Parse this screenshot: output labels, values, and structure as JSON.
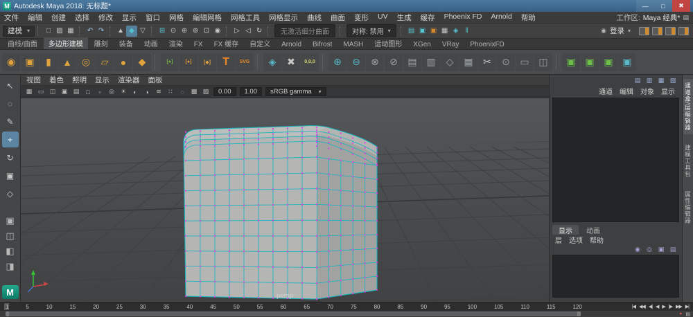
{
  "ui": {
    "chevron_down": "▾",
    "login_icon": "◉",
    "workspace_icon": "▤"
  },
  "title_bar": {
    "logo": "M",
    "title": "Autodesk Maya 2018: 无标题*",
    "minimize_glyph": "—",
    "maximize_glyph": "□",
    "close_glyph": "✖"
  },
  "menu_bar": {
    "items": [
      "文件",
      "编辑",
      "创建",
      "选择",
      "修改",
      "显示",
      "窗口",
      "网格",
      "编辑网格",
      "网格工具",
      "网格显示",
      "曲线",
      "曲面",
      "变形",
      "UV",
      "生成",
      "缓存",
      "Phoenix FD",
      "Arnold",
      "帮助"
    ],
    "workspace_label": "工作区:",
    "workspace_value": "Maya 经典*"
  },
  "status_line": {
    "mode_label": "建模",
    "login_label": "登录",
    "left_items": [
      {
        "type": "sep"
      },
      {
        "type": "icon",
        "name": "new-scene-icon",
        "glyph": "□",
        "color": "#c8c8c8"
      },
      {
        "type": "icon",
        "name": "open-scene-icon",
        "glyph": "▨",
        "color": "#c8c8c8"
      },
      {
        "type": "icon",
        "name": "save-scene-icon",
        "glyph": "▦",
        "color": "#c8c8c8"
      },
      {
        "type": "sep"
      },
      {
        "type": "icon",
        "name": "undo-icon",
        "glyph": "↶",
        "color": "#9fc6e8"
      },
      {
        "type": "icon",
        "name": "redo-icon",
        "glyph": "↷",
        "color": "#9fc6e8"
      },
      {
        "type": "sep"
      },
      {
        "type": "icon",
        "name": "select-hierarchy-icon",
        "glyph": "▲",
        "color": "#c8c8c8"
      },
      {
        "type": "icon",
        "name": "select-object-icon",
        "glyph": "◆",
        "color": "#54c3d0",
        "active": true
      },
      {
        "type": "icon",
        "name": "select-component-icon",
        "glyph": "▽",
        "color": "#c8c8c8"
      },
      {
        "type": "sep"
      },
      {
        "type": "icon",
        "name": "snap-grid-icon",
        "glyph": "⊞",
        "color": "#54c3d0"
      },
      {
        "type": "icon",
        "name": "snap-curve-icon",
        "glyph": "⊙",
        "color": "#c8c8c8"
      },
      {
        "type": "icon",
        "name": "snap-point-icon",
        "glyph": "⊕",
        "color": "#c8c8c8"
      },
      {
        "type": "icon",
        "name": "snap-center-icon",
        "glyph": "⊚",
        "color": "#c8c8c8"
      },
      {
        "type": "icon",
        "name": "snap-viewplane-icon",
        "glyph": "⊡",
        "color": "#c8c8c8"
      },
      {
        "type": "icon",
        "name": "make-live-icon",
        "glyph": "◉",
        "color": "#c8c8c8"
      },
      {
        "type": "sep"
      },
      {
        "type": "icon",
        "name": "input-connections-icon",
        "glyph": "▷",
        "color": "#c8c8c8"
      },
      {
        "type": "icon",
        "name": "output-connections-icon",
        "glyph": "◁",
        "color": "#c8c8c8"
      },
      {
        "type": "icon",
        "name": "construction-history-icon",
        "glyph": "↻",
        "color": "#c8c8c8"
      },
      {
        "type": "sep"
      },
      {
        "type": "field",
        "name": "subdiv-status-field",
        "label": "无激活细分曲面"
      },
      {
        "type": "sep"
      },
      {
        "type": "dropdown",
        "name": "symmetry-dropdown",
        "label": "对称: 禁用"
      },
      {
        "type": "sep"
      },
      {
        "type": "icon",
        "name": "open-render-view-icon",
        "glyph": "▤",
        "color": "#54c3d0"
      },
      {
        "type": "icon",
        "name": "render-frame-icon",
        "glyph": "▣",
        "color": "#54c3d0"
      },
      {
        "type": "icon",
        "name": "ipr-render-icon",
        "glyph": "▣",
        "color": "#d98a2b"
      },
      {
        "type": "icon",
        "name": "render-settings-icon",
        "glyph": "▦",
        "color": "#c8c8c8"
      },
      {
        "type": "icon",
        "name": "launch-render-icon",
        "glyph": "◈",
        "color": "#54c3d0"
      },
      {
        "type": "icon",
        "name": "pause-icon",
        "glyph": "‖",
        "color": "#54c3d0"
      }
    ],
    "right_items": [
      {
        "type": "icon",
        "name": "toggle-modeling-toolkit-icon",
        "cls": "panel-toggle"
      },
      {
        "type": "icon",
        "name": "toggle-attribute-editor-icon",
        "cls": "panel-toggle"
      },
      {
        "type": "icon",
        "name": "toggle-tool-settings-icon",
        "cls": "panel-toggle"
      },
      {
        "type": "icon",
        "name": "toggle-channel-box-icon",
        "cls": "panel-toggle"
      }
    ]
  },
  "shelf": {
    "tabs": [
      {
        "label": "曲线/曲面"
      },
      {
        "label": "多边形建模",
        "active": true
      },
      {
        "label": "雕刻"
      },
      {
        "label": "装备"
      },
      {
        "label": "动画"
      },
      {
        "label": "渲染"
      },
      {
        "label": "FX"
      },
      {
        "label": "FX 缓存"
      },
      {
        "label": "自定义"
      },
      {
        "label": "Arnold"
      },
      {
        "label": "Bifrost"
      },
      {
        "label": "MASH"
      },
      {
        "label": "运动图形"
      },
      {
        "label": "XGen"
      },
      {
        "label": "VRay"
      },
      {
        "label": "PhoenixFD"
      }
    ],
    "icons": [
      {
        "name": "polygon-sphere-icon",
        "glyph": "◉",
        "color": "#e0a33c"
      },
      {
        "name": "polygon-cube-icon",
        "glyph": "▣",
        "color": "#e0a33c"
      },
      {
        "name": "polygon-cylinder-icon",
        "glyph": "▮",
        "color": "#e0a33c"
      },
      {
        "name": "polygon-cone-icon",
        "glyph": "▲",
        "color": "#e0a33c"
      },
      {
        "name": "polygon-torus-icon",
        "glyph": "◎",
        "color": "#e0a33c"
      },
      {
        "name": "polygon-plane-icon",
        "glyph": "▱",
        "color": "#e0a33c"
      },
      {
        "name": "polygon-disc-icon",
        "glyph": "●",
        "color": "#e0a33c"
      },
      {
        "name": "platonic-solid-icon",
        "glyph": "◆",
        "color": "#e0a33c"
      },
      {
        "type": "sep"
      },
      {
        "name": "smooth-mesh-icon",
        "glyph": "[●]",
        "color": "#7ab648",
        "cls": "tiny"
      },
      {
        "name": "subdiv-proxy-icon",
        "glyph": "[●]",
        "color": "#e0a33c",
        "cls": "tiny"
      },
      {
        "name": "crease-tool-icon",
        "glyph": "[◆]",
        "color": "#e0a33c",
        "cls": "tiny"
      },
      {
        "name": "type-tool-icon",
        "glyph": "T",
        "color": "#e8882a",
        "cls": "big"
      },
      {
        "name": "svg-tool-icon",
        "glyph": "SVG",
        "color": "#e8882a",
        "cls": "tiny"
      },
      {
        "type": "sep"
      },
      {
        "name": "construction-plane-icon",
        "glyph": "◈",
        "color": "#58b8c8"
      },
      {
        "name": "free-image-plane-icon",
        "glyph": "✖",
        "color": "#c8c8c8"
      },
      {
        "name": "origin-locator-icon",
        "glyph": "0,0,0",
        "color": "#d8d870",
        "cls": "tiny"
      },
      {
        "type": "sep"
      },
      {
        "name": "combine-icon",
        "glyph": "⊕",
        "color": "#58b8c8"
      },
      {
        "name": "separate-icon",
        "glyph": "⊖",
        "color": "#58b8c8"
      },
      {
        "name": "boolean-union-icon",
        "glyph": "⊗",
        "color": "#9aa0a4"
      },
      {
        "name": "boolean-difference-icon",
        "glyph": "⊘",
        "color": "#9aa0a4"
      },
      {
        "name": "smooth-icon",
        "glyph": "▤",
        "color": "#9aa0a4"
      },
      {
        "name": "extrude-icon",
        "glyph": "▥",
        "color": "#9aa0a4"
      },
      {
        "name": "bevel-icon",
        "glyph": "◇",
        "color": "#9aa0a4"
      },
      {
        "name": "bridge-icon",
        "glyph": "▦",
        "color": "#9aa0a4"
      },
      {
        "name": "multi-cut-icon",
        "glyph": "✂",
        "color": "#c8c8c8"
      },
      {
        "name": "target-weld-icon",
        "glyph": "⊙",
        "color": "#9aa0a4"
      },
      {
        "name": "quad-draw-icon",
        "glyph": "▭",
        "color": "#9aa0a4"
      },
      {
        "name": "mirror-icon",
        "glyph": "◫",
        "color": "#9aa0a4"
      },
      {
        "type": "sep"
      },
      {
        "name": "smooth-preview-off-icon",
        "glyph": "▣",
        "color": "#6cc04a"
      },
      {
        "name": "smooth-preview-cage-icon",
        "glyph": "▣",
        "color": "#6cc04a"
      },
      {
        "name": "smooth-preview-on-icon",
        "glyph": "▣",
        "color": "#6cc04a"
      },
      {
        "name": "object-mode-icon",
        "glyph": "▣",
        "color": "#58b8c8"
      }
    ]
  },
  "toolbox": {
    "tools": [
      {
        "name": "select-tool-icon",
        "glyph": "↖"
      },
      {
        "name": "lasso-tool-icon",
        "glyph": "◌"
      },
      {
        "name": "paint-select-tool-icon",
        "glyph": "✎"
      },
      {
        "name": "move-tool-icon",
        "glyph": "+",
        "active": true
      },
      {
        "name": "rotate-tool-icon",
        "glyph": "↻"
      },
      {
        "name": "scale-tool-icon",
        "glyph": "▣"
      },
      {
        "name": "last-tool-icon",
        "glyph": "◇"
      }
    ],
    "layouts": [
      {
        "name": "layout-single-pane-icon",
        "glyph": "▣"
      },
      {
        "name": "layout-four-pane-icon",
        "glyph": "◫"
      },
      {
        "name": "layout-two-pane-icon",
        "glyph": "◧"
      },
      {
        "name": "layout-outliner-icon",
        "glyph": "◨"
      }
    ],
    "logo": "M"
  },
  "viewport": {
    "menus": [
      "视图",
      "着色",
      "照明",
      "显示",
      "渲染器",
      "面板"
    ],
    "icons": [
      {
        "name": "grid-toggle-icon",
        "glyph": "▦"
      },
      {
        "name": "film-gate-icon",
        "glyph": "▭"
      },
      {
        "name": "resolution-gate-icon",
        "glyph": "◫"
      },
      {
        "name": "gate-mask-icon",
        "glyph": "▣"
      },
      {
        "name": "field-chart-icon",
        "glyph": "▤"
      },
      {
        "name": "safe-action-icon",
        "glyph": "□"
      },
      {
        "name": "safe-title-icon",
        "glyph": "▫"
      },
      {
        "name": "frame-all-icon",
        "glyph": "◎"
      },
      {
        "name": "lighting-icon",
        "glyph": "☀"
      },
      {
        "name": "shadows-icon",
        "glyph": "◐"
      },
      {
        "name": "ao-icon",
        "glyph": "◑"
      },
      {
        "name": "motion-blur-icon",
        "glyph": "≋"
      },
      {
        "name": "multisample-icon",
        "glyph": "∷"
      },
      {
        "name": "xray-icon",
        "glyph": "◌"
      },
      {
        "name": "wireframe-shaded-icon",
        "glyph": "▩"
      },
      {
        "name": "textured-icon",
        "glyph": "▨"
      }
    ],
    "exposure": "0.00",
    "contrast": "1.00",
    "view_transform": "sRGB gamma",
    "camera_label": "persp"
  },
  "right_panel": {
    "top_icons": [
      {
        "name": "channel-slider-mode-icon",
        "glyph": "▤",
        "color": "#9fb0d8"
      },
      {
        "name": "channel-speed-icon",
        "glyph": "▥",
        "color": "#9fb0d8"
      },
      {
        "name": "channel-hyperbolic-icon",
        "glyph": "▦",
        "color": "#9fb0d8"
      },
      {
        "name": "channel-settings-icon",
        "glyph": "▧",
        "color": "#9fb0d8"
      }
    ],
    "channel_menus": [
      "通道",
      "编辑",
      "对象",
      "显示"
    ],
    "editor_tabs": [
      {
        "label": "显示",
        "active": true
      },
      {
        "label": "动画"
      }
    ],
    "layer_menus": [
      "层",
      "选项",
      "帮助"
    ],
    "layer_icons": [
      {
        "name": "layer-visibility-icon",
        "glyph": "◉",
        "color": "#a8a0d0"
      },
      {
        "name": "layer-playback-icon",
        "glyph": "◎",
        "color": "#a8a0d0"
      },
      {
        "name": "layer-new-empty-icon",
        "glyph": "▣",
        "color": "#a8a0d0"
      },
      {
        "name": "layer-new-selected-icon",
        "glyph": "▤",
        "color": "#a8a0d0"
      }
    ]
  },
  "right_strip": {
    "tabs": [
      {
        "label": "通道盒/层编辑器",
        "name": "tab-channel-box-layer-editor",
        "active": true
      },
      {
        "label": "建模工具包",
        "name": "tab-modeling-toolkit"
      },
      {
        "label": "属性编辑器",
        "name": "tab-attribute-editor"
      }
    ]
  },
  "timeline": {
    "ticks": [
      "1",
      "5",
      "10",
      "15",
      "20",
      "25",
      "30",
      "35",
      "40",
      "45",
      "50",
      "55",
      "60",
      "65",
      "70",
      "75",
      "80",
      "85",
      "90",
      "95",
      "100",
      "105",
      "110",
      "115",
      "120"
    ],
    "playback": [
      {
        "name": "go-to-start-button",
        "glyph": "|◀"
      },
      {
        "name": "step-back-frame-button",
        "glyph": "◀◀"
      },
      {
        "name": "step-back-key-button",
        "glyph": "◀|"
      },
      {
        "name": "play-backward-button",
        "glyph": "◀"
      },
      {
        "name": "play-forward-button",
        "glyph": "▶"
      },
      {
        "name": "step-forward-key-button",
        "glyph": "|▶"
      },
      {
        "name": "step-forward-frame-button",
        "glyph": "▶▶"
      },
      {
        "name": "go-to-end-button",
        "glyph": "▶|"
      }
    ]
  },
  "range_bar": {
    "buttons": [
      {
        "name": "auto-keyframe-icon",
        "glyph": "●",
        "color": "#c05a5a"
      },
      {
        "name": "animation-preferences-icon",
        "glyph": "▤",
        "color": "#c8c8c8"
      }
    ]
  }
}
